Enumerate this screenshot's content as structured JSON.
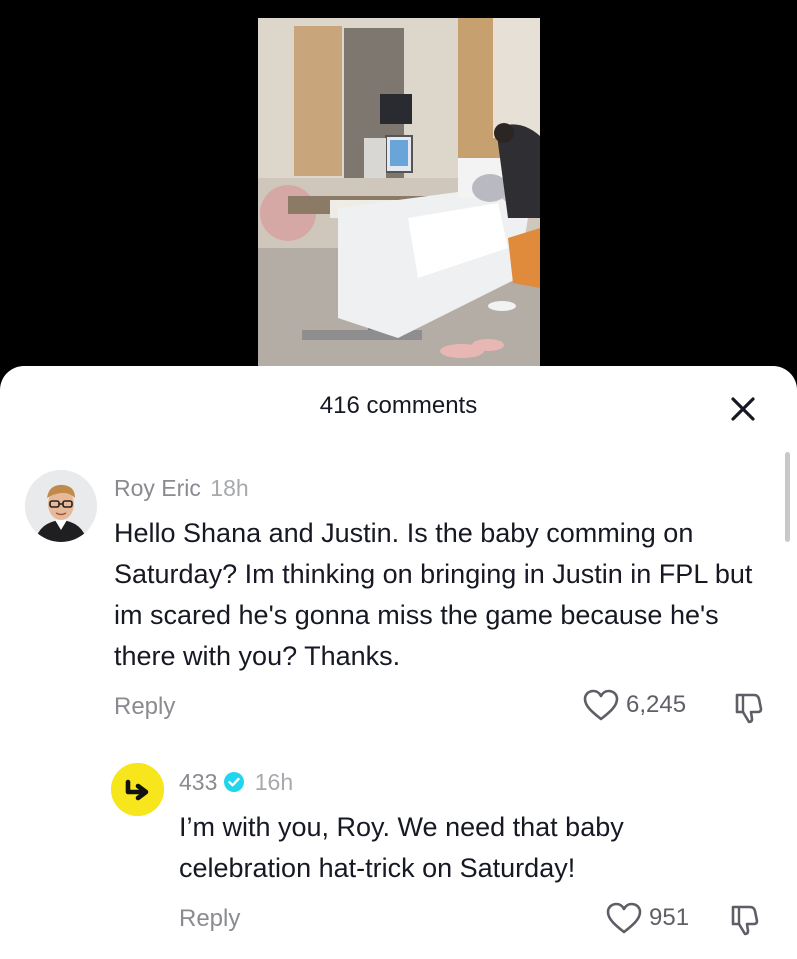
{
  "comments_panel": {
    "title": "416 comments",
    "close_icon": "close-x-icon"
  },
  "comments": [
    {
      "author": "Roy Eric",
      "time": "18h",
      "text": "Hello Shana and Justin. Is the baby comming on Saturday? Im thinking on bringing in Justin in FPL but im scared he's gonna miss the game because he's there with you? Thanks.",
      "reply_label": "Reply",
      "likes": "6,245",
      "avatar_icon": "profile-photo-avatar"
    },
    {
      "author": "433",
      "verified": true,
      "time": "16h",
      "text": "I’m with you, Roy. We need that baby celebration hat-trick on Saturday!",
      "reply_label": "Reply",
      "likes": "951",
      "avatar_icon": "433-logo-avatar",
      "avatar_color": "#f6e61b"
    }
  ],
  "colors": {
    "verified_badge": "#20d5ec",
    "primary_text": "#161823",
    "secondary_text": "#8a8b91"
  }
}
